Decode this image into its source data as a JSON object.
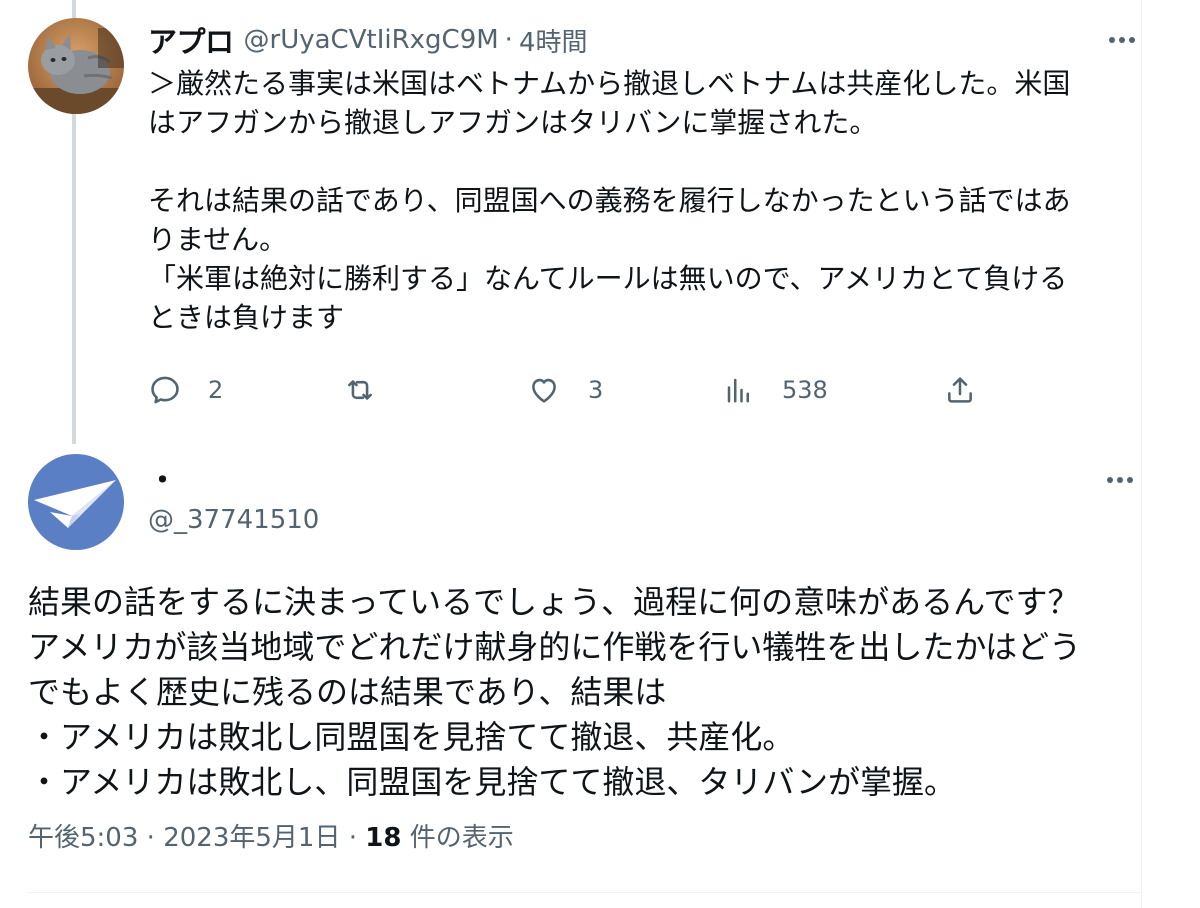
{
  "reply": {
    "display_name": "アプロ",
    "handle": "@rUyaCVtIiRxgC9M",
    "separator": "·",
    "time": "4時間",
    "more_label": "…",
    "text": {
      "line1": "＞厳然たる事実は米国はベトナムから撤退しベトナムは共産化した。米国",
      "line2": "はアフガンから撤退しアフガンはタリバンに掌握された。",
      "line3": "それは結果の話であり、同盟国への義務を履行しなかったという話ではあ",
      "line4": "りません。",
      "line5": "「米軍は絶対に勝利する」なんてルールは無いので、アメリカとて負ける",
      "line6": "ときは負けます"
    },
    "actions": {
      "replies": "2",
      "likes": "3",
      "views": "538"
    }
  },
  "main": {
    "display_name": "・",
    "handle": "@_37741510",
    "more_label": "…",
    "text": {
      "line1": "結果の話をするに決まっているでしょう、過程に何の意味があるんです？",
      "line2": "アメリカが該当地域でどれだけ献身的に作戦を行い犠牲を出したかはどう",
      "line3": "でもよく歴史に残るのは結果であり、結果は",
      "line4": "・アメリカは敗北し同盟国を見捨てて撤退、共産化。",
      "line5": "・アメリカは敗北し、同盟国を見捨てて撤退、タリバンが掌握。"
    },
    "meta": {
      "time": "午後5:03",
      "separator": " · ",
      "date": "2023年5月1日",
      "views_count": "18",
      "views_label": " 件の表示"
    }
  },
  "colors": {
    "text_primary": "#0f1419",
    "text_secondary": "#536471",
    "thread_line": "#cfd9de",
    "divider": "#eff3f4",
    "avatar_blue": "#5b7fc4"
  },
  "icons": {
    "reply": "reply-icon",
    "retweet": "retweet-icon",
    "like": "heart-icon",
    "views": "analytics-icon",
    "share": "share-icon",
    "more": "more-icon"
  }
}
